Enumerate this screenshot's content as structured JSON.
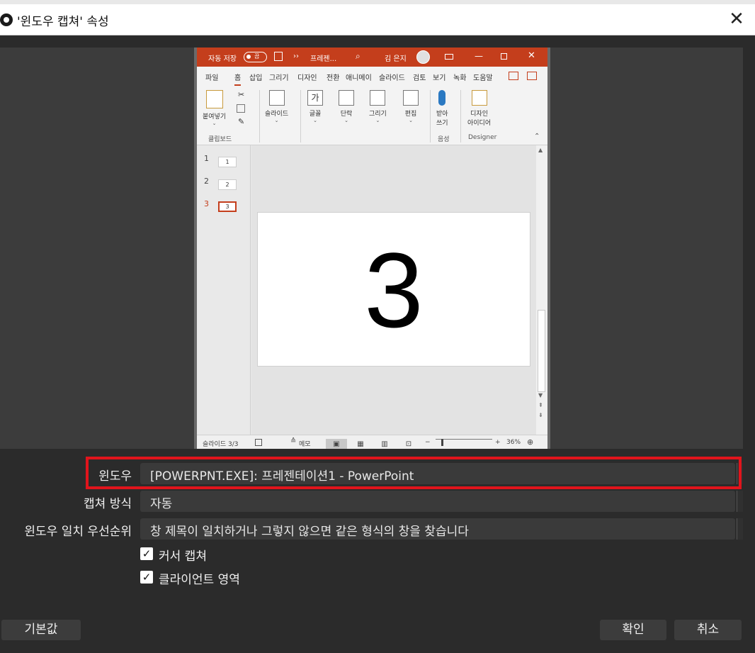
{
  "window": {
    "title": "'윈도우 캡쳐' 속성",
    "close": "✕"
  },
  "ppt": {
    "titlebar": {
      "autosave": "자동 저장",
      "toggle_state": "끔",
      "more": "››",
      "doc": "프레젠...",
      "user": "김 은지"
    },
    "tabs": [
      "파일",
      "홈",
      "삽입",
      "그리기",
      "디자인",
      "전환",
      "애니메이",
      "슬라이드",
      "검토",
      "보기",
      "녹화",
      "도움말"
    ],
    "ribbon": {
      "paste": "붙여넣기",
      "clipboard": "클립보드",
      "slide": "슬라이드",
      "font": "글꼴",
      "font_glyph": "가",
      "paragraph": "단락",
      "drawing": "그리기",
      "editing": "편집",
      "dictate_1": "받아",
      "dictate_2": "쓰기",
      "voice": "음성",
      "designer_1": "디자인",
      "designer_2": "아이디어",
      "designer": "Designer"
    },
    "slides": [
      {
        "num": "1",
        "label": "1"
      },
      {
        "num": "2",
        "label": "2"
      },
      {
        "num": "3",
        "label": "3"
      }
    ],
    "current_slide_text": "3",
    "status": {
      "slide_count": "슬라이드 3/3",
      "notes": "메모",
      "zoom": "36%"
    }
  },
  "form": {
    "window_label": "윈도우",
    "window_value": "[POWERPNT.EXE]: 프레젠테이션1 - PowerPoint",
    "capture_label": "캡쳐 방식",
    "capture_value": "자동",
    "priority_label": "윈도우 일치 우선순위",
    "priority_value": "창 제목이 일치하거나 그렇지 않으면 같은 형식의 창을 찾습니다",
    "cursor_label": "커서 캡쳐",
    "client_label": "클라이언트 영역"
  },
  "buttons": {
    "defaults": "기본값",
    "ok": "확인",
    "cancel": "취소"
  }
}
